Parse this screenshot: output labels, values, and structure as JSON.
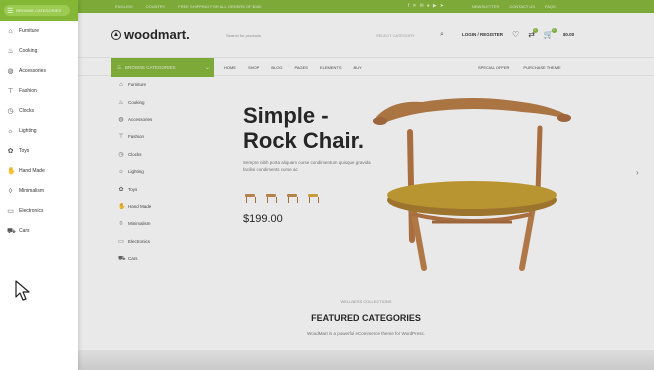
{
  "topbar": {
    "left_text": "",
    "links": [
      "ENGLISH",
      "COUNTRY",
      "FREE SHIPPING FOR ALL ORDERS OF $150"
    ],
    "social_icons": [
      "facebook-icon",
      "twitter-icon",
      "email-icon",
      "pinterest-icon",
      "youtube-icon",
      "telegram-icon"
    ],
    "right_links": [
      "NEWSLETTER",
      "CONTACT US",
      "FAQS"
    ]
  },
  "header": {
    "logo": "woodmart.",
    "search_placeholder": "Search for products",
    "search_category": "SELECT CATEGORY",
    "account_label": "LOGIN / REGISTER",
    "wishlist_count": "0",
    "compare_count": "0",
    "cart_count": "0",
    "cart_total": "$0.00"
  },
  "nav": {
    "browse_label": "BROWSE CATEGORIES",
    "links": [
      "HOME",
      "SHOP",
      "BLOG",
      "PAGES",
      "ELEMENTS",
      "BUY"
    ],
    "right_links": [
      "SPECIAL OFFER",
      "PURCHASE THEME"
    ]
  },
  "categories": [
    {
      "label": "Furniture",
      "icon": "sofa-icon"
    },
    {
      "label": "Cooking",
      "icon": "pot-icon"
    },
    {
      "label": "Accessories",
      "icon": "bag-icon"
    },
    {
      "label": "Fashion",
      "icon": "shirt-icon"
    },
    {
      "label": "Clocks",
      "icon": "clock-icon"
    },
    {
      "label": "Lighting",
      "icon": "bulb-icon"
    },
    {
      "label": "Toys",
      "icon": "toy-icon"
    },
    {
      "label": "Hand Made",
      "icon": "hand-icon"
    },
    {
      "label": "Minimalism",
      "icon": "vase-icon"
    },
    {
      "label": "Electronics",
      "icon": "electronics-icon"
    },
    {
      "label": "Cars",
      "icon": "car-icon"
    }
  ],
  "hero": {
    "title_line1": "Simple -",
    "title_line2": "Rock Chair.",
    "description": "Sempre nibh porta aliquam curse condimentum quisque gravida facilisi condiments curse ac",
    "price": "$199.00"
  },
  "featured": {
    "subtitle": "WELLNESS COLLECTIONS",
    "title": "FEATURED CATEGORIES",
    "description": "WoodMart is a powerful eCommerce theme for WordPress."
  },
  "colors": {
    "brand_green": "#83b735",
    "text_dark": "#222222"
  }
}
